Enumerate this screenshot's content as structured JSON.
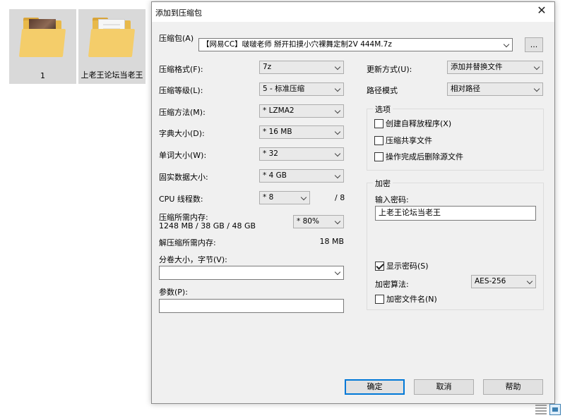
{
  "desktop": {
    "items": [
      {
        "label": "1"
      },
      {
        "label": "上老王论坛当老王"
      }
    ]
  },
  "dialog": {
    "title": "添加到压缩包",
    "archive": {
      "label": "压缩包(A)",
      "value": "【网易CC】啵啵老师 掰开扣摸小穴裸舞定制2V 444M.7z",
      "browse_label": "..."
    },
    "left": {
      "format": {
        "label": "压缩格式(F):",
        "value": "7z"
      },
      "level": {
        "label": "压缩等级(L):",
        "value": "5 - 标准压缩"
      },
      "method": {
        "label": "压缩方法(M):",
        "value": "* LZMA2"
      },
      "dict": {
        "label": "字典大小(D):",
        "value": "* 16 MB"
      },
      "word": {
        "label": "单词大小(W):",
        "value": "* 32"
      },
      "solid": {
        "label": "固实数据大小:",
        "value": "* 4 GB"
      },
      "threads": {
        "label": "CPU 线程数:",
        "value": "* 8",
        "max": "/ 8"
      },
      "mem_compress": {
        "label": "压缩所需内存:",
        "detail": "1248 MB / 38 GB / 48 GB",
        "value": "* 80%"
      },
      "mem_decompress": {
        "label": "解压缩所需内存:",
        "value": "18 MB"
      },
      "split": {
        "label": "分卷大小，字节(V):",
        "value": ""
      },
      "params": {
        "label": "参数(P):",
        "value": ""
      }
    },
    "right": {
      "update": {
        "label": "更新方式(U):",
        "value": "添加并替换文件"
      },
      "path": {
        "label": "路径模式",
        "value": "相对路径"
      },
      "options": {
        "title": "选项",
        "sfx": {
          "label": "创建自释放程序(X)",
          "checked": false
        },
        "shared": {
          "label": "压缩共享文件",
          "checked": false
        },
        "delete": {
          "label": "操作完成后删除源文件",
          "checked": false
        }
      },
      "encryption": {
        "title": "加密",
        "password_label": "输入密码:",
        "password_value": "上老王论坛当老王",
        "show_password": {
          "label": "显示密码(S)",
          "checked": true
        },
        "method_label": "加密算法:",
        "method_value": "AES-256",
        "encrypt_names": {
          "label": "加密文件名(N)",
          "checked": false
        }
      }
    },
    "buttons": {
      "ok": "确定",
      "cancel": "取消",
      "help": "帮助"
    }
  }
}
